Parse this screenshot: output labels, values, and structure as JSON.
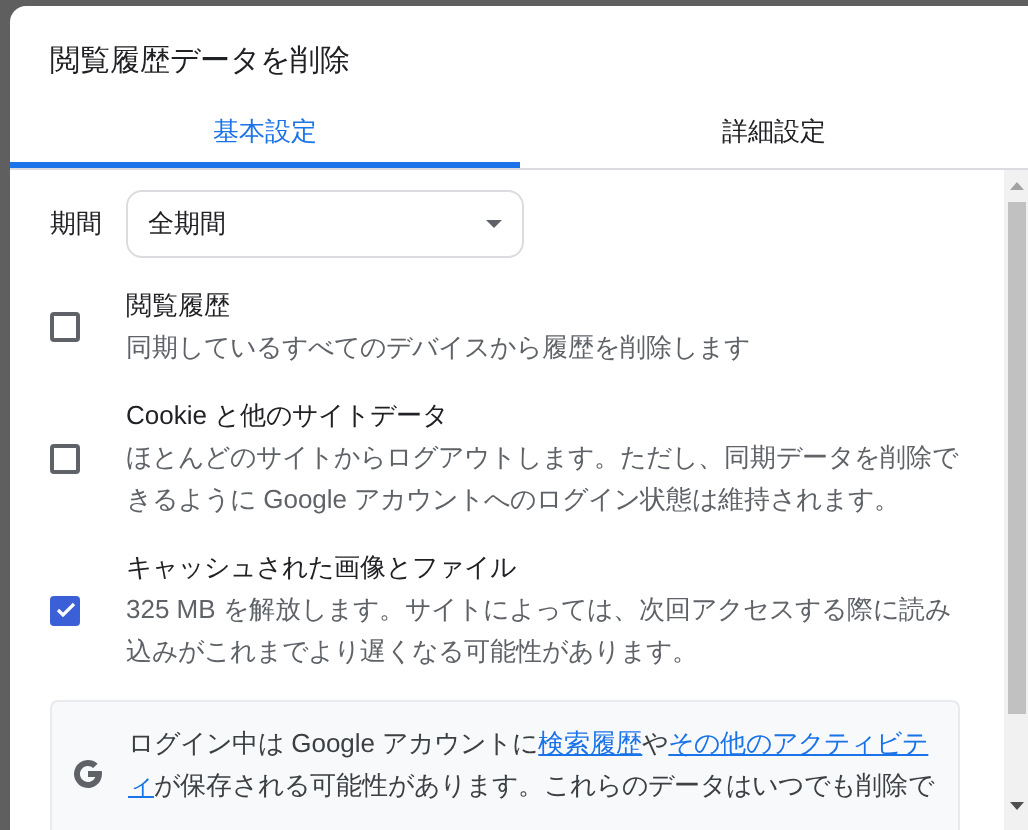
{
  "dialog": {
    "title": "閲覧履歴データを削除"
  },
  "tabs": [
    {
      "label": "基本設定",
      "selected": true
    },
    {
      "label": "詳細設定",
      "selected": false
    }
  ],
  "period": {
    "label": "期間",
    "value": "全期間"
  },
  "options": [
    {
      "title": "閲覧履歴",
      "description": "同期しているすべてのデバイスから履歴を削除します",
      "checked": false
    },
    {
      "title": "Cookie と他のサイトデータ",
      "description": "ほとんどのサイトからログアウトします。ただし、同期データを削除できるように Google アカウントへのログイン状態は維持されます。",
      "checked": false
    },
    {
      "title": "キャッシュされた画像とファイル",
      "description": "325 MB を解放します。サイトによっては、次回アクセスする際に読み込みがこれまでより遅くなる可能性があります。",
      "checked": true
    }
  ],
  "notice": {
    "segments": [
      {
        "kind": "text",
        "text": "ログイン中は Google アカウントに"
      },
      {
        "kind": "link",
        "text": "検索履歴"
      },
      {
        "kind": "text",
        "text": "や"
      },
      {
        "kind": "link",
        "text": "その他のアクティビテ"
      },
      {
        "kind": "link",
        "text": "ィ"
      },
      {
        "kind": "text",
        "text": "が保存される可能性があります。これらのデータはいつでも削除で"
      }
    ]
  }
}
